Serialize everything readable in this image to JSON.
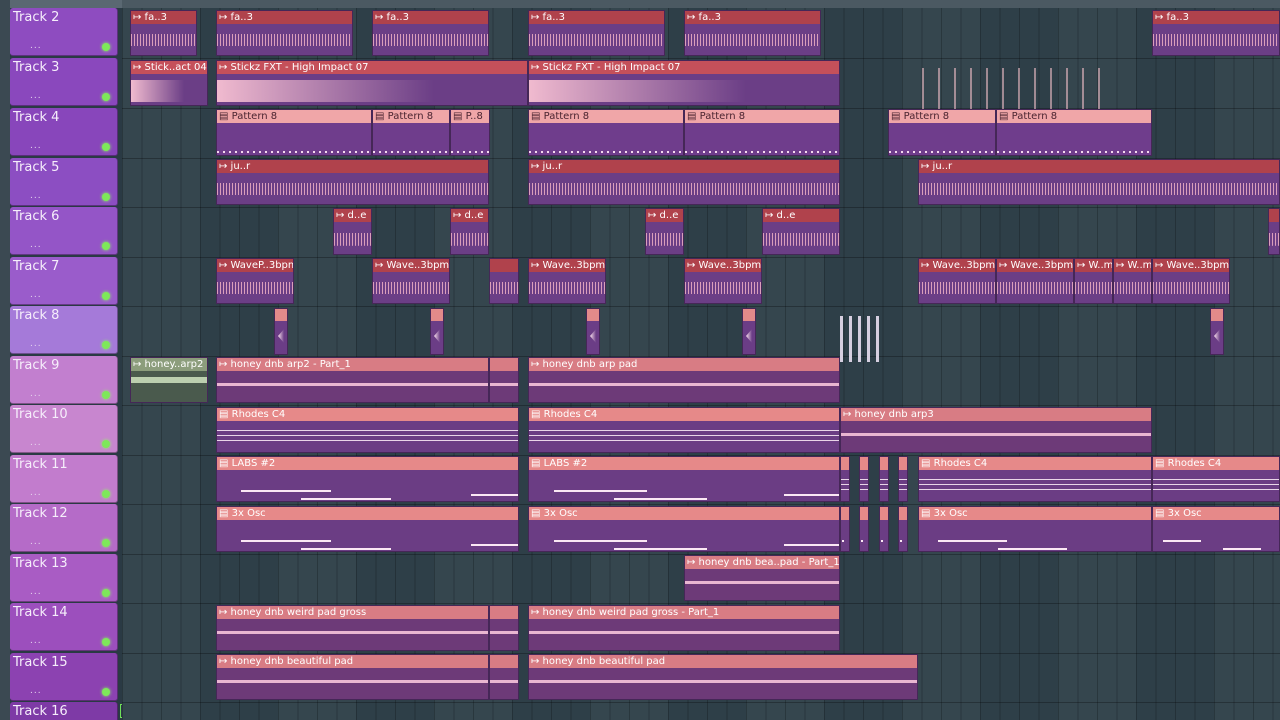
{
  "tracks": [
    {
      "name": "Track 2",
      "color": "#8e4cc0"
    },
    {
      "name": "Track 3",
      "color": "#8a48bd"
    },
    {
      "name": "Track 4",
      "color": "#8846bb"
    },
    {
      "name": "Track 5",
      "color": "#8c4ec2"
    },
    {
      "name": "Track 6",
      "color": "#9455c7"
    },
    {
      "name": "Track 7",
      "color": "#9a5ccb"
    },
    {
      "name": "Track 8",
      "color": "#a57ad9"
    },
    {
      "name": "Track 9",
      "color": "#c27fcf"
    },
    {
      "name": "Track 10",
      "color": "#c886cf"
    },
    {
      "name": "Track 11",
      "color": "#c27ccd"
    },
    {
      "name": "Track 12",
      "color": "#b56bc8"
    },
    {
      "name": "Track 13",
      "color": "#a95cc4"
    },
    {
      "name": "Track 14",
      "color": "#9c4fbd"
    },
    {
      "name": "Track 15",
      "color": "#8c42b1"
    },
    {
      "name": "Track 16",
      "color": "#7e3aa6"
    }
  ],
  "track_dots": "...",
  "clips": {
    "fa3": "↦ fa..3",
    "stickz_short": "↦ Stick..act 04",
    "stickz_long": "↦ Stickz FXT - High Impact 07",
    "pattern8": "▤ Pattern 8",
    "p8": "▤ P..8",
    "jur": "↦ ju..r",
    "de": "↦ d..e",
    "wavep": "↦ WaveP..3bpm",
    "wave": "↦ Wave..3bpm",
    "wm": "↦ W..m",
    "honey_arp2_short": "↦ honey..arp2",
    "honey_arp2_part1": "↦ honey dnb arp2 - Part_1",
    "honey_arp_pad": "↦ honey dnb arp pad",
    "rhodes": "▤ Rhodes C4",
    "honey_arp3": "↦ honey dnb arp3",
    "labs2": "▤ LABS #2",
    "osc3": "▤ 3x Osc",
    "honey_beapad": "↦ honey dnb bea..pad - Part_1",
    "weird_pad": "↦ honey dnb weird pad gross",
    "weird_pad_part1": "↦ honey dnb weird pad gross - Part_1",
    "beautiful_pad": "↦ honey dnb beautiful pad"
  }
}
